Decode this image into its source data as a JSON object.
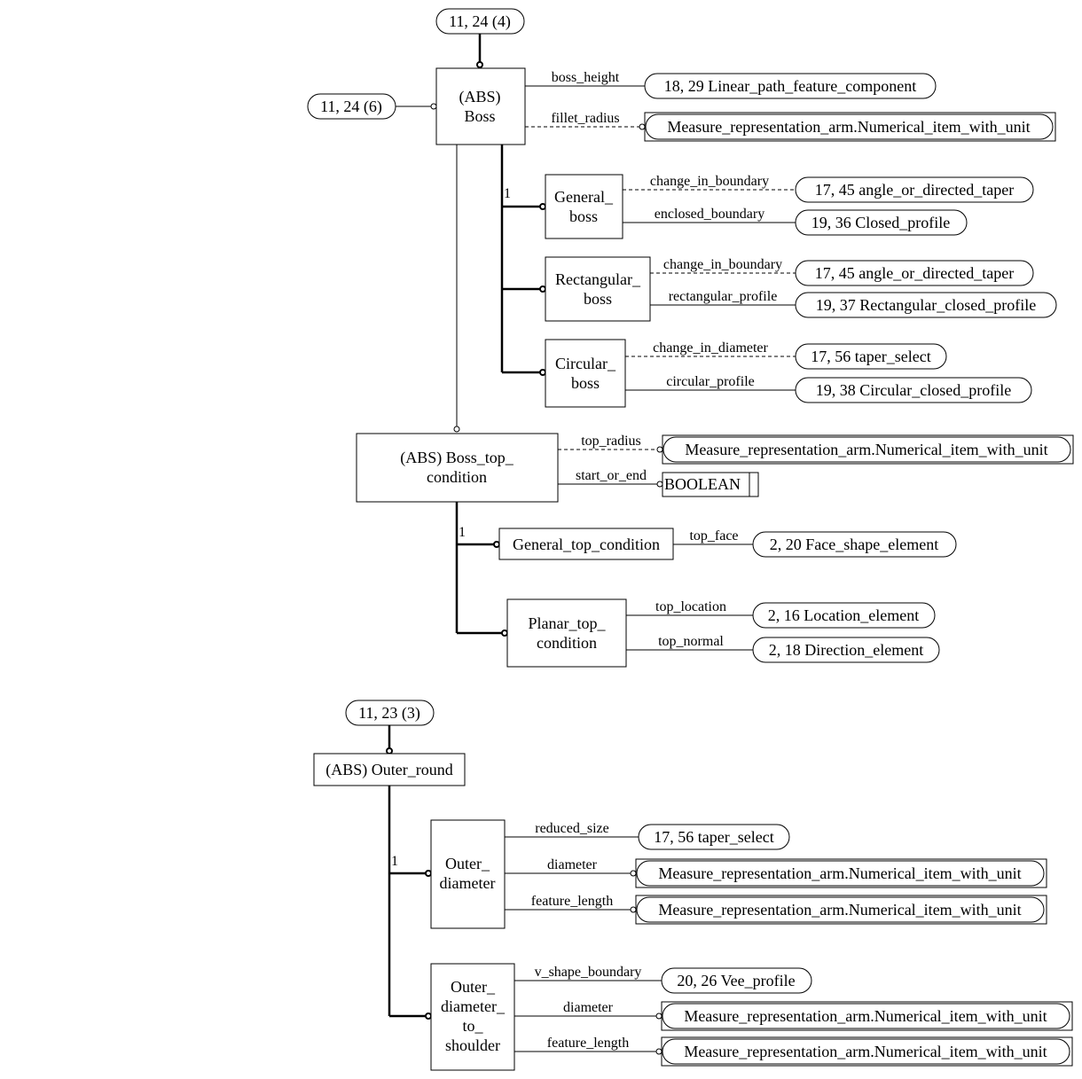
{
  "diagram": {
    "top_refs": {
      "boss_parent": "11, 24 (4)",
      "boss_side": "11, 24 (6)",
      "outer_round_parent": "11, 23 (3)"
    },
    "entities": {
      "boss": [
        "(ABS)",
        "Boss"
      ],
      "general_boss": [
        "General_",
        "boss"
      ],
      "rectangular_boss": [
        "Rectangular_",
        "boss"
      ],
      "circular_boss": [
        "Circular_",
        "boss"
      ],
      "boss_top_condition": [
        "(ABS) Boss_top_",
        "condition"
      ],
      "general_top_condition": [
        "General_top_condition"
      ],
      "planar_top_condition": [
        "Planar_top_",
        "condition"
      ],
      "outer_round": [
        "(ABS) Outer_round"
      ],
      "outer_diameter": [
        "Outer_",
        "diameter"
      ],
      "outer_diameter_to_shoulder": [
        "Outer_",
        "diameter_",
        "to_",
        "shoulder"
      ]
    },
    "cardinality": {
      "boss_subtypes": "1",
      "top_condition_subtypes": "1",
      "outer_round_subtypes": "1"
    },
    "attributes": {
      "boss_height": "boss_height",
      "fillet_radius": "fillet_radius",
      "gb_change_in_boundary": "change_in_boundary",
      "gb_enclosed_boundary": "enclosed_boundary",
      "rb_change_in_boundary": "change_in_boundary",
      "rb_rectangular_profile": "rectangular_profile",
      "cb_change_in_diameter": "change_in_diameter",
      "cb_circular_profile": "circular_profile",
      "top_radius": "top_radius",
      "start_or_end": "start_or_end",
      "top_face": "top_face",
      "top_location": "top_location",
      "top_normal": "top_normal",
      "od_reduced_size": "reduced_size",
      "od_diameter": "diameter",
      "od_feature_length": "feature_length",
      "ods_v_shape_boundary": "v_shape_boundary",
      "ods_diameter": "diameter",
      "ods_feature_length": "feature_length"
    },
    "refs": {
      "linear_path": "18, 29 Linear_path_feature_component",
      "fillet_measure": "Measure_representation_arm.Numerical_item_with_unit",
      "gb_taper": "17, 45 angle_or_directed_taper",
      "gb_closed_profile": "19, 36 Closed_profile",
      "rb_taper": "17, 45 angle_or_directed_taper",
      "rb_rect_profile": "19, 37 Rectangular_closed_profile",
      "cb_taper_select": "17, 56 taper_select",
      "cb_circ_profile": "19, 38 Circular_closed_profile",
      "top_radius_measure": "Measure_representation_arm.Numerical_item_with_unit",
      "boolean": "BOOLEAN",
      "face_shape": "2, 20 Face_shape_element",
      "location": "2, 16 Location_element",
      "direction": "2, 18 Direction_element",
      "od_taper_select": "17, 56 taper_select",
      "od_diameter_measure": "Measure_representation_arm.Numerical_item_with_unit",
      "od_length_measure": "Measure_representation_arm.Numerical_item_with_unit",
      "vee_profile": "20, 26 Vee_profile",
      "ods_diameter_measure": "Measure_representation_arm.Numerical_item_with_unit",
      "ods_length_measure": "Measure_representation_arm.Numerical_item_with_unit"
    }
  }
}
